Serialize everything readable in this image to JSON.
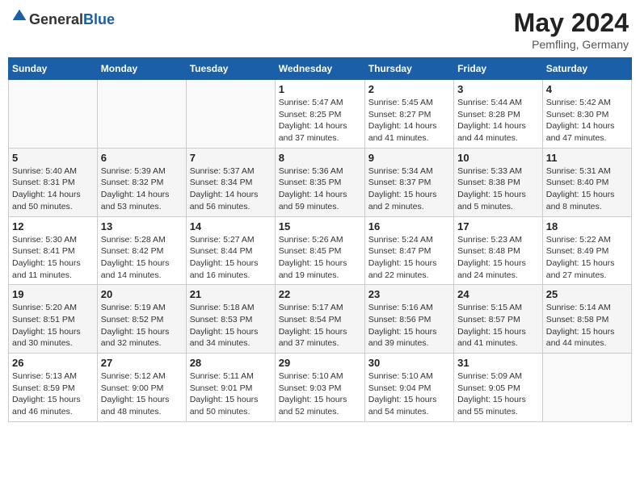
{
  "header": {
    "logo_general": "General",
    "logo_blue": "Blue",
    "month_year": "May 2024",
    "location": "Pemfling, Germany"
  },
  "days_of_week": [
    "Sunday",
    "Monday",
    "Tuesday",
    "Wednesday",
    "Thursday",
    "Friday",
    "Saturday"
  ],
  "weeks": [
    [
      {
        "day": "",
        "info": ""
      },
      {
        "day": "",
        "info": ""
      },
      {
        "day": "",
        "info": ""
      },
      {
        "day": "1",
        "info": "Sunrise: 5:47 AM\nSunset: 8:25 PM\nDaylight: 14 hours\nand 37 minutes."
      },
      {
        "day": "2",
        "info": "Sunrise: 5:45 AM\nSunset: 8:27 PM\nDaylight: 14 hours\nand 41 minutes."
      },
      {
        "day": "3",
        "info": "Sunrise: 5:44 AM\nSunset: 8:28 PM\nDaylight: 14 hours\nand 44 minutes."
      },
      {
        "day": "4",
        "info": "Sunrise: 5:42 AM\nSunset: 8:30 PM\nDaylight: 14 hours\nand 47 minutes."
      }
    ],
    [
      {
        "day": "5",
        "info": "Sunrise: 5:40 AM\nSunset: 8:31 PM\nDaylight: 14 hours\nand 50 minutes."
      },
      {
        "day": "6",
        "info": "Sunrise: 5:39 AM\nSunset: 8:32 PM\nDaylight: 14 hours\nand 53 minutes."
      },
      {
        "day": "7",
        "info": "Sunrise: 5:37 AM\nSunset: 8:34 PM\nDaylight: 14 hours\nand 56 minutes."
      },
      {
        "day": "8",
        "info": "Sunrise: 5:36 AM\nSunset: 8:35 PM\nDaylight: 14 hours\nand 59 minutes."
      },
      {
        "day": "9",
        "info": "Sunrise: 5:34 AM\nSunset: 8:37 PM\nDaylight: 15 hours\nand 2 minutes."
      },
      {
        "day": "10",
        "info": "Sunrise: 5:33 AM\nSunset: 8:38 PM\nDaylight: 15 hours\nand 5 minutes."
      },
      {
        "day": "11",
        "info": "Sunrise: 5:31 AM\nSunset: 8:40 PM\nDaylight: 15 hours\nand 8 minutes."
      }
    ],
    [
      {
        "day": "12",
        "info": "Sunrise: 5:30 AM\nSunset: 8:41 PM\nDaylight: 15 hours\nand 11 minutes."
      },
      {
        "day": "13",
        "info": "Sunrise: 5:28 AM\nSunset: 8:42 PM\nDaylight: 15 hours\nand 14 minutes."
      },
      {
        "day": "14",
        "info": "Sunrise: 5:27 AM\nSunset: 8:44 PM\nDaylight: 15 hours\nand 16 minutes."
      },
      {
        "day": "15",
        "info": "Sunrise: 5:26 AM\nSunset: 8:45 PM\nDaylight: 15 hours\nand 19 minutes."
      },
      {
        "day": "16",
        "info": "Sunrise: 5:24 AM\nSunset: 8:47 PM\nDaylight: 15 hours\nand 22 minutes."
      },
      {
        "day": "17",
        "info": "Sunrise: 5:23 AM\nSunset: 8:48 PM\nDaylight: 15 hours\nand 24 minutes."
      },
      {
        "day": "18",
        "info": "Sunrise: 5:22 AM\nSunset: 8:49 PM\nDaylight: 15 hours\nand 27 minutes."
      }
    ],
    [
      {
        "day": "19",
        "info": "Sunrise: 5:20 AM\nSunset: 8:51 PM\nDaylight: 15 hours\nand 30 minutes."
      },
      {
        "day": "20",
        "info": "Sunrise: 5:19 AM\nSunset: 8:52 PM\nDaylight: 15 hours\nand 32 minutes."
      },
      {
        "day": "21",
        "info": "Sunrise: 5:18 AM\nSunset: 8:53 PM\nDaylight: 15 hours\nand 34 minutes."
      },
      {
        "day": "22",
        "info": "Sunrise: 5:17 AM\nSunset: 8:54 PM\nDaylight: 15 hours\nand 37 minutes."
      },
      {
        "day": "23",
        "info": "Sunrise: 5:16 AM\nSunset: 8:56 PM\nDaylight: 15 hours\nand 39 minutes."
      },
      {
        "day": "24",
        "info": "Sunrise: 5:15 AM\nSunset: 8:57 PM\nDaylight: 15 hours\nand 41 minutes."
      },
      {
        "day": "25",
        "info": "Sunrise: 5:14 AM\nSunset: 8:58 PM\nDaylight: 15 hours\nand 44 minutes."
      }
    ],
    [
      {
        "day": "26",
        "info": "Sunrise: 5:13 AM\nSunset: 8:59 PM\nDaylight: 15 hours\nand 46 minutes."
      },
      {
        "day": "27",
        "info": "Sunrise: 5:12 AM\nSunset: 9:00 PM\nDaylight: 15 hours\nand 48 minutes."
      },
      {
        "day": "28",
        "info": "Sunrise: 5:11 AM\nSunset: 9:01 PM\nDaylight: 15 hours\nand 50 minutes."
      },
      {
        "day": "29",
        "info": "Sunrise: 5:10 AM\nSunset: 9:03 PM\nDaylight: 15 hours\nand 52 minutes."
      },
      {
        "day": "30",
        "info": "Sunrise: 5:10 AM\nSunset: 9:04 PM\nDaylight: 15 hours\nand 54 minutes."
      },
      {
        "day": "31",
        "info": "Sunrise: 5:09 AM\nSunset: 9:05 PM\nDaylight: 15 hours\nand 55 minutes."
      },
      {
        "day": "",
        "info": ""
      }
    ]
  ]
}
